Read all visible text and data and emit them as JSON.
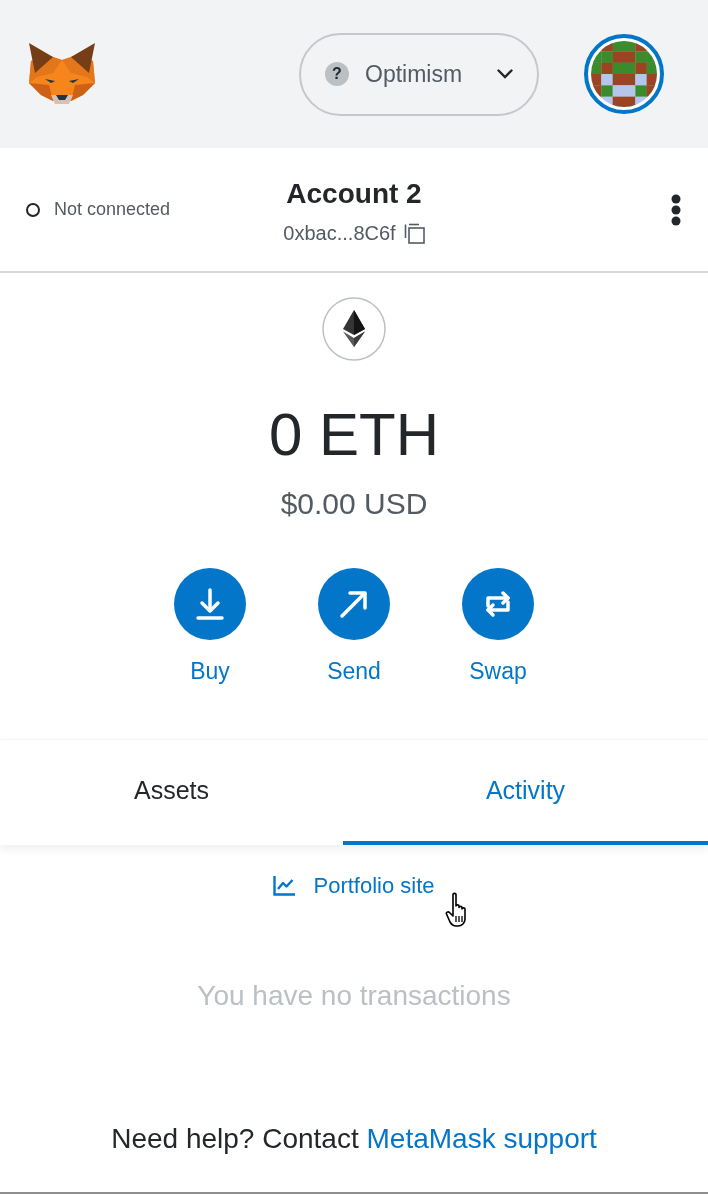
{
  "header": {
    "network": {
      "icon": "?",
      "label": "Optimism"
    }
  },
  "account": {
    "connected": false,
    "connection_status": "Not connected",
    "name": "Account 2",
    "address": "0xbac...8C6f"
  },
  "balance": {
    "amount": "0 ETH",
    "fiat": "$0.00 USD"
  },
  "actions": [
    {
      "kind": "buy",
      "label": "Buy"
    },
    {
      "kind": "send",
      "label": "Send"
    },
    {
      "kind": "swap",
      "label": "Swap"
    }
  ],
  "tabs": [
    {
      "label": "Assets",
      "selected": false
    },
    {
      "label": "Activity",
      "selected": true
    }
  ],
  "activity": {
    "portfolio_link": "Portfolio site",
    "empty_message": "You have no transactions"
  },
  "help": {
    "text": "Need help? Contact",
    "link": "MetaMask support"
  }
}
